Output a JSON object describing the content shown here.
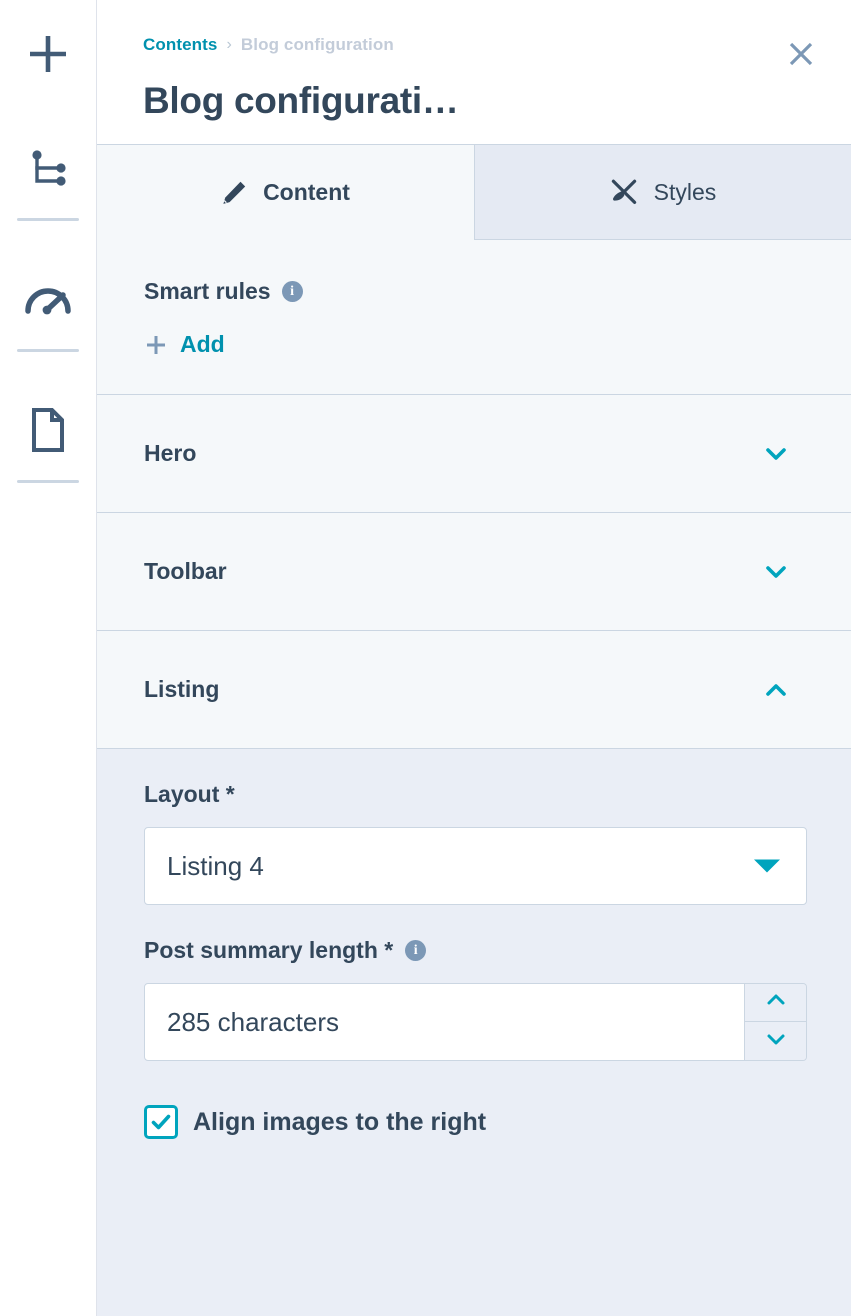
{
  "sidebar": {
    "items": [
      {
        "name": "add",
        "icon": "plus-icon"
      },
      {
        "name": "content-tree",
        "icon": "hierarchy-tree-icon"
      },
      {
        "name": "optimization",
        "icon": "gauge-icon"
      },
      {
        "name": "page-document",
        "icon": "document-icon"
      }
    ]
  },
  "header": {
    "breadcrumb": {
      "parent": "Contents",
      "separator": "›",
      "current": "Blog configuration"
    },
    "title": "Blog configurati…",
    "close_label": "×"
  },
  "tabs": [
    {
      "label": "Content",
      "icon": "pencil-icon",
      "active": true
    },
    {
      "label": "Styles",
      "icon": "paintbrush-icon",
      "active": false
    }
  ],
  "smart_rules": {
    "label": "Smart rules",
    "info_icon": "info-icon",
    "info_glyph": "i",
    "add_label": "Add",
    "add_icon": "plus-icon"
  },
  "sections": [
    {
      "title": "Hero",
      "expanded": false,
      "chevron": "chevron-down-icon"
    },
    {
      "title": "Toolbar",
      "expanded": false,
      "chevron": "chevron-down-icon"
    },
    {
      "title": "Listing",
      "expanded": true,
      "chevron": "chevron-up-icon"
    }
  ],
  "listing_fields": {
    "layout": {
      "label": "Layout *",
      "value": "Listing 4",
      "options": [
        "Listing 4"
      ],
      "caret_icon": "caret-down-icon"
    },
    "post_summary_length": {
      "label": "Post summary length *",
      "info_icon": "info-icon",
      "info_glyph": "i",
      "value": "285 characters",
      "stepper_up_icon": "chevron-up-icon",
      "stepper_down_icon": "chevron-down-icon"
    },
    "align_images": {
      "label": "Align images to the right",
      "checked": true,
      "check_icon": "checkmark-icon"
    }
  },
  "colors": {
    "accent_teal": "#00a4bd",
    "link_teal": "#0091ae",
    "text_dark": "#33475b",
    "muted_blue": "#7c98b6",
    "border": "#cbd6e2",
    "panel_light": "#f5f8fa",
    "panel_body": "#eaeef6",
    "tab_inactive": "#e5eaf3"
  }
}
